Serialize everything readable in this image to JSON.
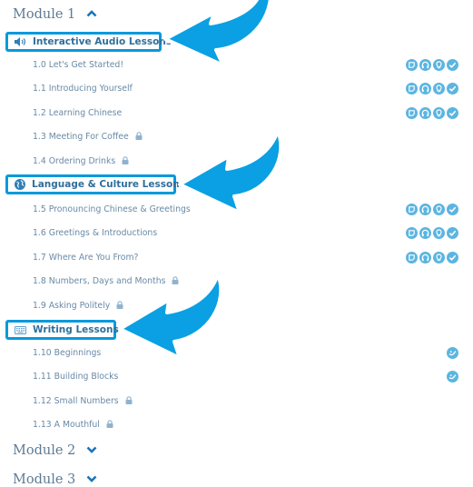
{
  "modules": [
    {
      "label": "Module 1",
      "expanded": true
    },
    {
      "label": "Module 2",
      "expanded": false
    },
    {
      "label": "Module 3",
      "expanded": false
    }
  ],
  "sections": [
    {
      "label": "Interactive Audio Lessons",
      "icon": "speaker-icon"
    },
    {
      "label": "Language & Culture Lessons",
      "icon": "globe-icon"
    },
    {
      "label": "Writing Lessons",
      "icon": "keyboard-icon"
    }
  ],
  "lessons": [
    {
      "label": "1.0 Let's Get Started!",
      "locked": false,
      "badges": [
        "notes-icon",
        "headphones-icon",
        "lightbulb-icon",
        "check-icon"
      ]
    },
    {
      "label": "1.1 Introducing Yourself",
      "locked": false,
      "badges": [
        "notes-icon",
        "headphones-icon",
        "lightbulb-icon",
        "check-icon"
      ]
    },
    {
      "label": "1.2 Learning Chinese",
      "locked": false,
      "badges": [
        "notes-icon",
        "headphones-icon",
        "lightbulb-icon",
        "check-icon"
      ]
    },
    {
      "label": "1.3 Meeting For Coffee",
      "locked": true,
      "badges": []
    },
    {
      "label": "1.4 Ordering Drinks",
      "locked": true,
      "badges": []
    },
    {
      "label": "1.5 Pronouncing Chinese & Greetings",
      "locked": false,
      "badges": [
        "notes-icon",
        "headphones-icon",
        "lightbulb-icon",
        "check-icon"
      ]
    },
    {
      "label": "1.6 Greetings & Introductions",
      "locked": false,
      "badges": [
        "notes-icon",
        "headphones-icon",
        "lightbulb-icon",
        "check-icon"
      ]
    },
    {
      "label": "1.7 Where Are You From?",
      "locked": false,
      "badges": [
        "notes-icon",
        "headphones-icon",
        "lightbulb-icon",
        "check-icon"
      ]
    },
    {
      "label": "1.8 Numbers, Days and Months",
      "locked": true,
      "badges": []
    },
    {
      "label": "1.9 Asking Politely",
      "locked": true,
      "badges": []
    },
    {
      "label": "1.10 Beginnings",
      "locked": false,
      "badges": [
        "brush-icon"
      ]
    },
    {
      "label": "1.11 Building Blocks",
      "locked": false,
      "badges": [
        "brush-icon"
      ]
    },
    {
      "label": "1.12 Small Numbers",
      "locked": true,
      "badges": []
    },
    {
      "label": "1.13 A Mouthful",
      "locked": true,
      "badges": []
    }
  ],
  "colors": {
    "accent": "#0799dc",
    "badge": "#5bb5e1",
    "section_text": "#2f6f9c",
    "lesson_text": "#6989a6",
    "module_text": "#5d7a93"
  }
}
